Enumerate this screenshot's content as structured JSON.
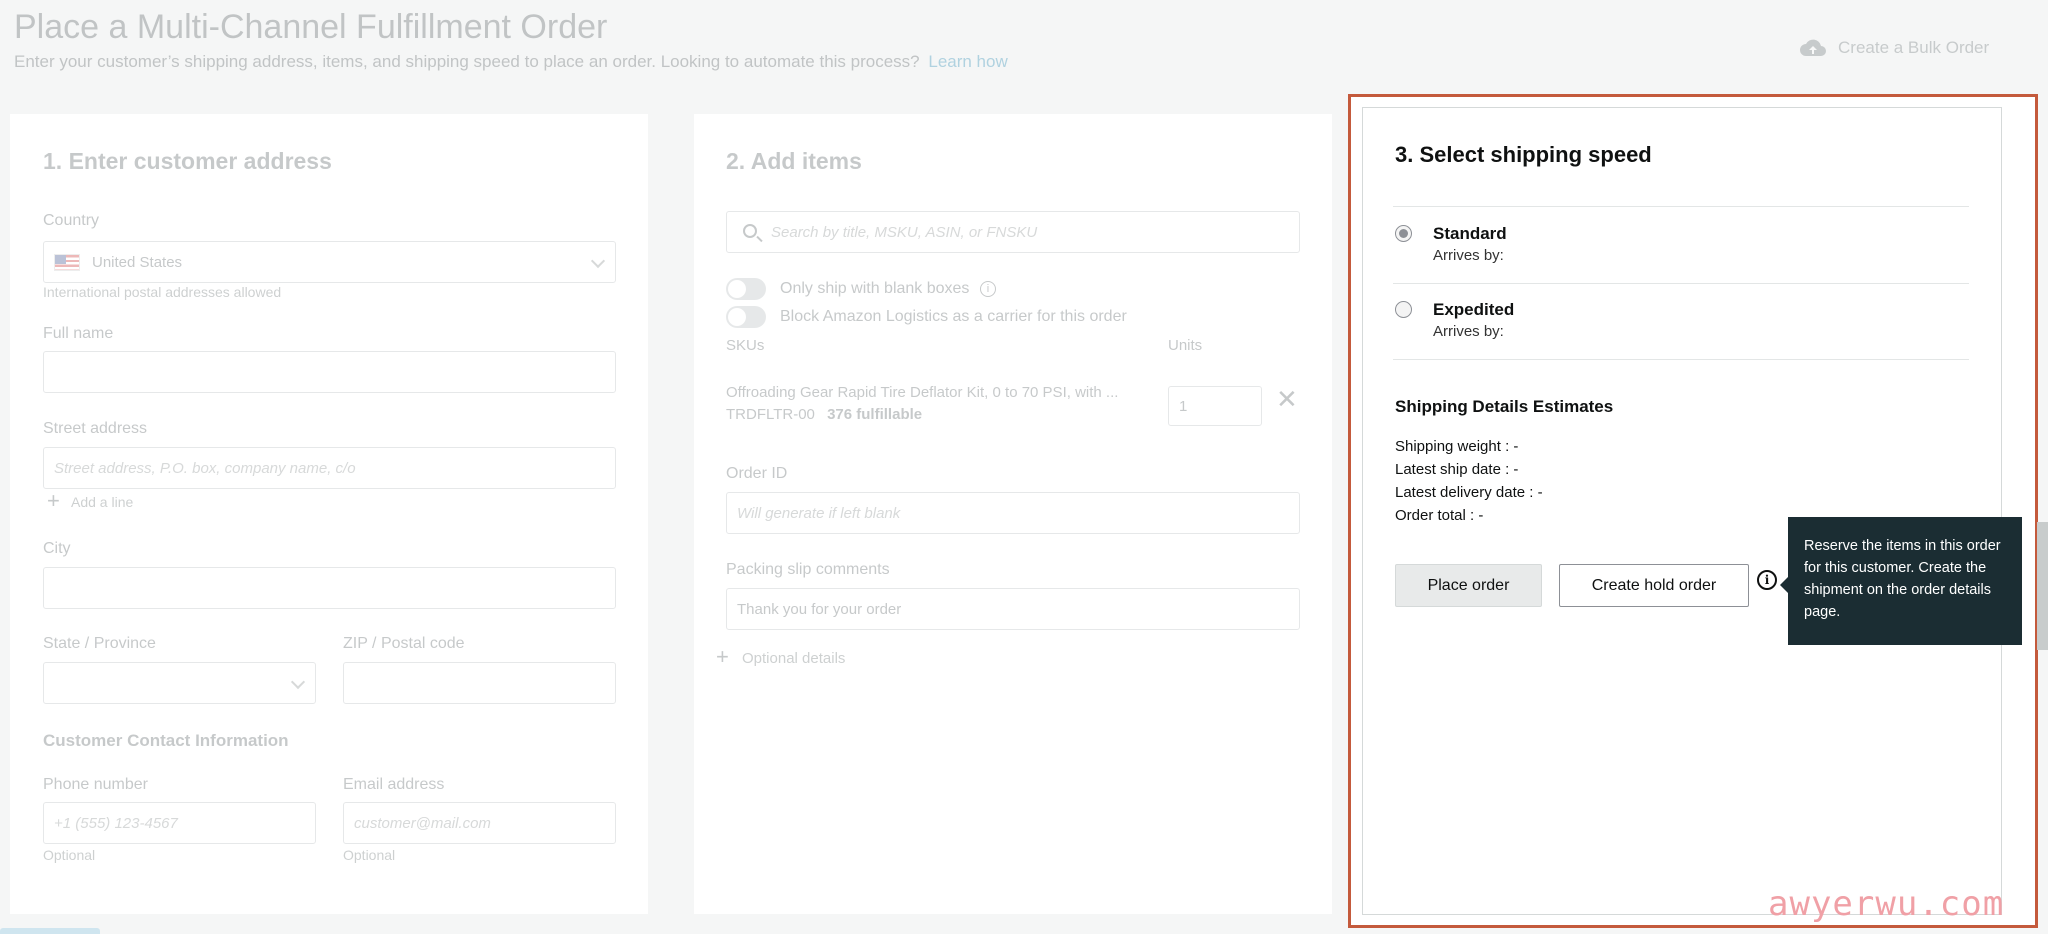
{
  "header": {
    "title": "Place a Multi-Channel Fulfillment Order",
    "subtitle": "Enter your customer’s shipping address, items, and shipping speed to place an order. Looking to automate this process?",
    "learn_link": "Learn how",
    "bulk_order_label": "Create a Bulk Order",
    "bulk_order_icon": "cloud-upload-icon"
  },
  "address": {
    "title": "1. Enter customer address",
    "country_label": "Country",
    "country_value": "United States",
    "country_hint": "International postal addresses allowed",
    "fullname_label": "Full name",
    "street_label": "Street address",
    "street_placeholder": "Street address, P.O. box, company name, c/o",
    "add_line": "Add a line",
    "city_label": "City",
    "state_label": "State / Province",
    "zip_label": "ZIP / Postal code",
    "contact_title": "Customer Contact Information",
    "phone_label": "Phone number",
    "phone_placeholder": "+1 (555) 123-4567",
    "phone_hint": "Optional",
    "email_label": "Email address",
    "email_placeholder": "customer@mail.com",
    "email_hint": "Optional"
  },
  "items": {
    "title": "2. Add items",
    "search_placeholder": "Search by title, MSKU, ASIN, or FNSKU",
    "toggle_blank_boxes": "Only ship with blank boxes",
    "toggle_block_logistics": "Block Amazon Logistics as a carrier for this order",
    "col_skus": "SKUs",
    "col_units": "Units",
    "sku_title": "Offroading Gear Rapid Tire Deflator Kit, 0 to 70 PSI, with ...",
    "sku_code": "TRDFLTR-00",
    "sku_fulfillable": "376 fulfillable",
    "sku_units": "1",
    "order_id_label": "Order ID",
    "order_id_placeholder": "Will generate if left blank",
    "packing_label": "Packing slip comments",
    "packing_value": "Thank you for your order",
    "optional_details": "Optional details"
  },
  "shipping": {
    "title": "3. Select shipping speed",
    "options": [
      {
        "label": "Standard",
        "sub": "Arrives by:",
        "checked": true
      },
      {
        "label": "Expedited",
        "sub": "Arrives by:",
        "checked": false
      }
    ],
    "estimates_title": "Shipping Details Estimates",
    "estimates": [
      "Shipping weight : -",
      "Latest ship date : -",
      "Latest delivery date : -",
      "Order total : -"
    ],
    "place_order": "Place order",
    "hold_order": "Create hold order",
    "info_glyph": "i",
    "tooltip": "Reserve the items in this order for this customer. Create the shipment on the order details page."
  },
  "watermark": "awyerwu.com",
  "colors": {
    "highlight_border": "#c45a3c",
    "tooltip_bg": "#1b2d33",
    "link": "#2a8bb4"
  }
}
